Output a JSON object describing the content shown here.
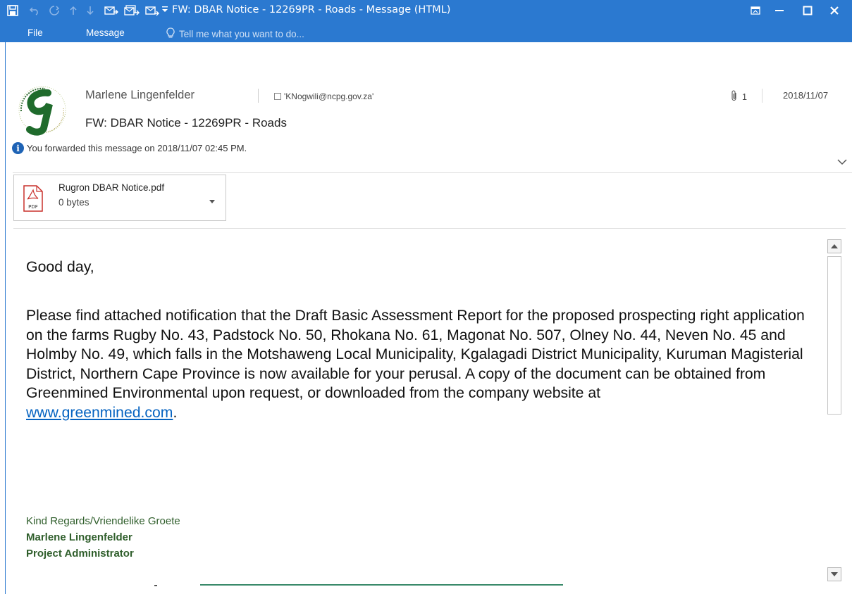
{
  "window": {
    "title": "FW: DBAR Notice - 12269PR - Roads  - Message (HTML)",
    "accent": "#2b79d0"
  },
  "ribbon": {
    "tabs": [
      "File",
      "Message"
    ],
    "tell_me": "Tell me what you want to do..."
  },
  "header": {
    "sender": "Marlene Lingenfelder",
    "recipient": "'KNogwili@ncpg.gov.za'",
    "subject": "FW: DBAR Notice - 12269PR - Roads",
    "attachment_count": "1",
    "date": "2018/11/07",
    "info": "You forwarded this message on 2018/11/07 02:45 PM."
  },
  "attachment": {
    "name": "Rugron DBAR Notice.pdf",
    "size": "0 bytes",
    "icon_label": "PDF"
  },
  "body": {
    "greeting": "Good day,",
    "paragraph": "Please find attached notification that the Draft Basic Assessment Report for the proposed prospecting right application on the farms Rugby No. 43, Padstock No. 50, Rhokana No. 61, Magonat No. 507, Olney No. 44, Neven No. 45 and Holmby No. 49, which falls in the Motshaweng Local Municipality, Kgalagadi District Municipality, Kuruman Magisterial District, Northern Cape Province is now available for your perusal. A copy of the document can be obtained from Greenmined Environmental upon request, or downloaded from the company website at",
    "link": "www.greenmined.com",
    "after_link": ".",
    "signature": {
      "regards": "Kind Regards/Vriendelike Groete",
      "name": "Marlene Lingenfelder",
      "title": "Project Administrator"
    }
  },
  "colors": {
    "title_bar": "#2b79d0",
    "signature_green": "#2f5e2b",
    "link_blue": "#0563c1"
  }
}
